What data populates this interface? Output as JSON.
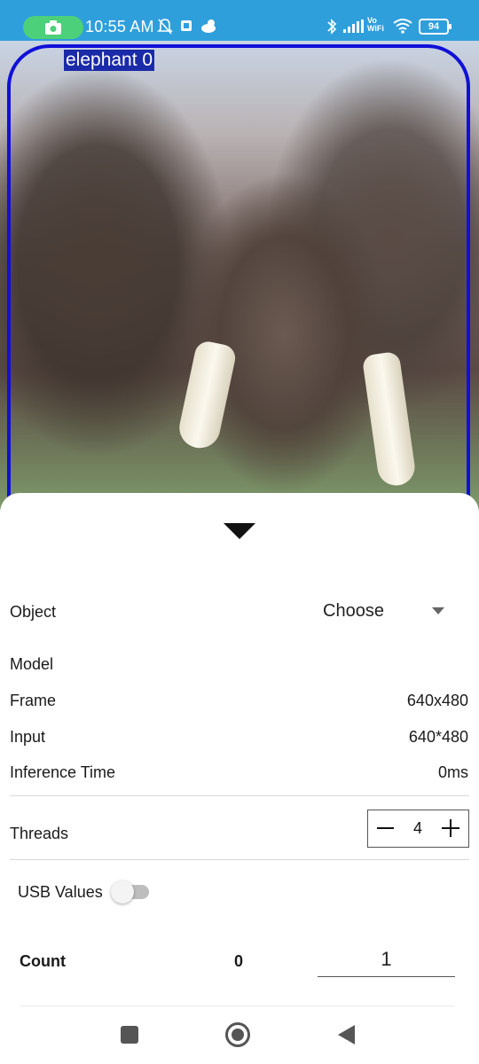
{
  "status_bar": {
    "time": "10:55 AM",
    "network_label": "Vo\nWiFi",
    "battery": "94",
    "icons": [
      "camera-icon",
      "mute-bell-icon",
      "cast-icon",
      "weather-icon",
      "bluetooth-icon",
      "signal-icon",
      "wifi-icon",
      "battery-icon"
    ]
  },
  "camera": {
    "detection_label": "elephant 0",
    "box_color": "#1010d8"
  },
  "panel": {
    "object": {
      "label": "Object",
      "selected": "Choose"
    },
    "model": {
      "label": "Model"
    },
    "frame": {
      "label": "Frame",
      "value": "640x480"
    },
    "input": {
      "label": "Input",
      "value": "640*480"
    },
    "inference": {
      "label": "Inference Time",
      "value": "0ms"
    },
    "threads": {
      "label": "Threads",
      "value": "4"
    },
    "usb": {
      "label": "USB Values",
      "enabled": false
    },
    "count": {
      "label": "Count",
      "value": "0",
      "input_value": "1"
    }
  },
  "nav": {
    "icons": [
      "recents-icon",
      "home-icon",
      "back-icon"
    ]
  },
  "colors": {
    "status_bar": "#2f9fdc",
    "pill": "#4cd07a"
  }
}
